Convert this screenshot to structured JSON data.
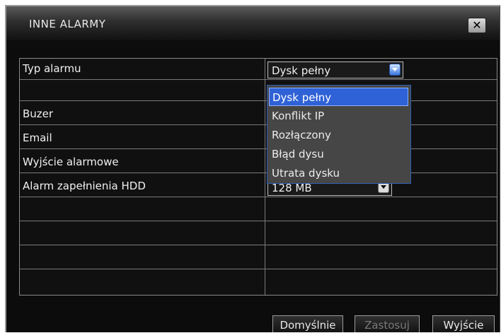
{
  "window": {
    "title": "INNE ALARMY"
  },
  "rows": [
    {
      "label": "Typ alarmu"
    },
    {
      "label": ""
    },
    {
      "label": "Buzer"
    },
    {
      "label": "Email"
    },
    {
      "label": "Wyjście alarmowe"
    },
    {
      "label": "Alarm zapełnienia HDD"
    },
    {
      "label": ""
    },
    {
      "label": ""
    },
    {
      "label": ""
    },
    {
      "label": ""
    }
  ],
  "alarm_type_select": {
    "value": "Dysk pełny"
  },
  "hdd_alarm_select": {
    "value": "128 MB"
  },
  "dropdown": {
    "options": [
      "Dysk pełny",
      "Konflikt IP",
      "Rozłączony",
      "Błąd dysu",
      "Utrata dysku"
    ],
    "selected_index": 0
  },
  "buttons": {
    "default": "Domyślnie",
    "apply": "Zastosuj",
    "exit": "Wyjście"
  },
  "icons": {
    "close": "close-icon",
    "dropdown_arrow": "chevron-down-icon"
  },
  "colors": {
    "highlight": "#2f62d6",
    "background": "#0c0c0c",
    "text": "#f0f0f0"
  }
}
